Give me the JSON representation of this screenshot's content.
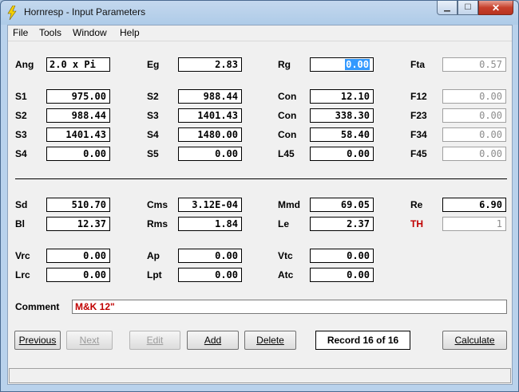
{
  "window": {
    "title": "Hornresp - Input Parameters"
  },
  "menu": [
    "File",
    "Tools",
    "Window",
    "Help"
  ],
  "fields": {
    "ang": {
      "label": "Ang",
      "value": "2.0 x Pi"
    },
    "eg": {
      "label": "Eg",
      "value": "2.83"
    },
    "rg": {
      "label": "Rg",
      "value": "0.00"
    },
    "fta": {
      "label": "Fta",
      "value": "0.57"
    },
    "s1": {
      "label": "S1",
      "value": "975.00"
    },
    "s2a": {
      "label": "S2",
      "value": "988.44"
    },
    "con1": {
      "label": "Con",
      "value": "12.10"
    },
    "f12": {
      "label": "F12",
      "value": "0.00"
    },
    "s2b": {
      "label": "S2",
      "value": "988.44"
    },
    "s3a": {
      "label": "S3",
      "value": "1401.43"
    },
    "con2": {
      "label": "Con",
      "value": "338.30"
    },
    "f23": {
      "label": "F23",
      "value": "0.00"
    },
    "s3b": {
      "label": "S3",
      "value": "1401.43"
    },
    "s4a": {
      "label": "S4",
      "value": "1480.00"
    },
    "con3": {
      "label": "Con",
      "value": "58.40"
    },
    "f34": {
      "label": "F34",
      "value": "0.00"
    },
    "s4b": {
      "label": "S4",
      "value": "0.00"
    },
    "s5": {
      "label": "S5",
      "value": "0.00"
    },
    "l45": {
      "label": "L45",
      "value": "0.00"
    },
    "f45": {
      "label": "F45",
      "value": "0.00"
    },
    "sd": {
      "label": "Sd",
      "value": "510.70"
    },
    "cms": {
      "label": "Cms",
      "value": "3.12E-04"
    },
    "mmd": {
      "label": "Mmd",
      "value": "69.05"
    },
    "re": {
      "label": "Re",
      "value": "6.90"
    },
    "bl": {
      "label": "Bl",
      "value": "12.37"
    },
    "rms": {
      "label": "Rms",
      "value": "1.84"
    },
    "le": {
      "label": "Le",
      "value": "2.37"
    },
    "th": {
      "label": "TH",
      "value": "1"
    },
    "vrc": {
      "label": "Vrc",
      "value": "0.00"
    },
    "ap": {
      "label": "Ap",
      "value": "0.00"
    },
    "vtc": {
      "label": "Vtc",
      "value": "0.00"
    },
    "lrc": {
      "label": "Lrc",
      "value": "0.00"
    },
    "lpt": {
      "label": "Lpt",
      "value": "0.00"
    },
    "atc": {
      "label": "Atc",
      "value": "0.00"
    }
  },
  "comment": {
    "label": "Comment",
    "value": "M&K 12\""
  },
  "buttons": {
    "previous": "Previous",
    "next": "Next",
    "edit": "Edit",
    "add": "Add",
    "delete": "Delete",
    "calculate": "Calculate"
  },
  "record": "Record 16 of 16",
  "colors": {
    "accent_red": "#c00000",
    "selection": "#3399ff"
  }
}
